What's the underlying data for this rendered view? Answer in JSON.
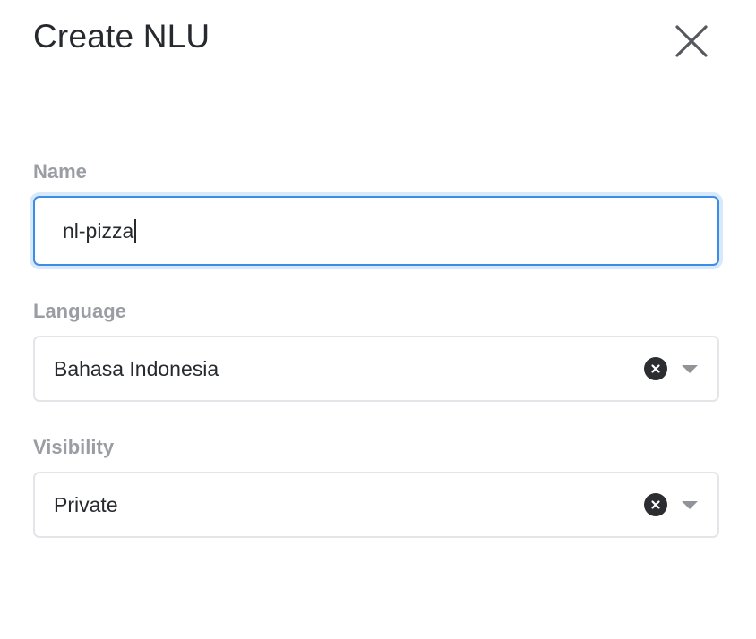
{
  "dialog": {
    "title": "Create NLU",
    "close_icon": "close-icon"
  },
  "form": {
    "name": {
      "label": "Name",
      "value": "nl-pizza"
    },
    "language": {
      "label": "Language",
      "selected": "Bahasa Indonesia",
      "clear_icon": "clear-icon",
      "arrow_icon": "chevron-down-icon"
    },
    "visibility": {
      "label": "Visibility",
      "selected": "Private",
      "clear_icon": "clear-icon",
      "arrow_icon": "chevron-down-icon"
    }
  },
  "colors": {
    "focus_border": "#3b8de8",
    "focus_glow": "#d7e9fb",
    "label": "#9a9da3",
    "text": "#26292e",
    "border": "#e4e5e8"
  }
}
